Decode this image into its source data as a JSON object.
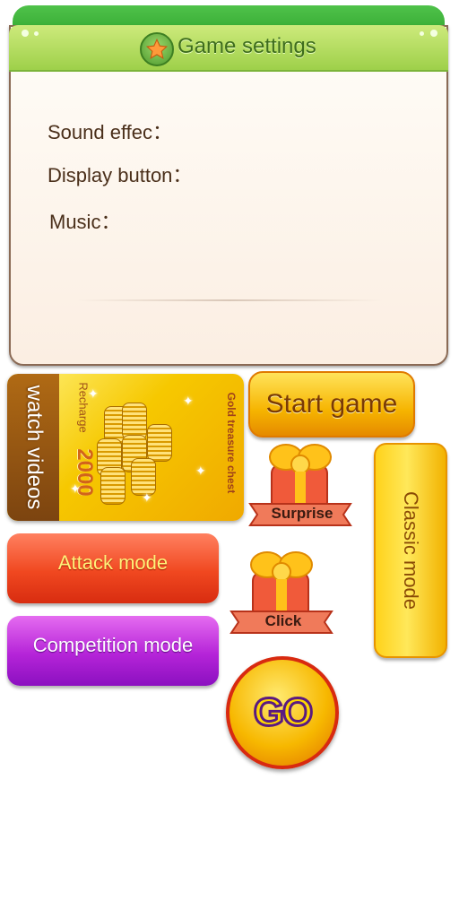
{
  "settings": {
    "title": "Game settings",
    "sound_label": "Sound effec：",
    "display_label": "Display button：",
    "music_label": "Music："
  },
  "video_card": {
    "title": "watch videos",
    "recharge_label": "Recharge",
    "recharge_amount": "2000",
    "chest_label": "Gold treasure chest"
  },
  "buttons": {
    "start_game": "Start game",
    "surprise": "Surprise",
    "classic_mode": "Classic mode",
    "attack_mode": "Attack mode",
    "click": "Click",
    "competition_mode": "Competition mode",
    "go": "GO"
  },
  "colors": {
    "header_green": "#9ed04a",
    "gold": "#f6c800",
    "attack_red": "#f04820",
    "competition_purple": "#b524d8"
  },
  "icons": [
    "star-icon",
    "gold-coins-icon",
    "gift-icon",
    "sparkle-icon"
  ]
}
